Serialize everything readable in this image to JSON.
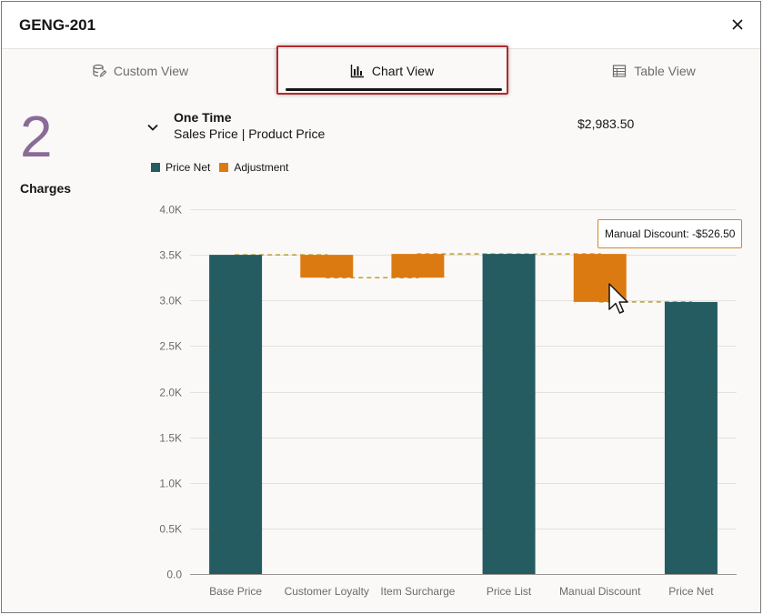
{
  "header": {
    "title": "GENG-201",
    "close_icon": "close-icon"
  },
  "tabs": [
    {
      "label": "Custom View",
      "icon": "database-edit-icon",
      "active": false
    },
    {
      "label": "Chart View",
      "icon": "bar-chart-icon",
      "active": true
    },
    {
      "label": "Table View",
      "icon": "table-icon",
      "active": false
    }
  ],
  "summary": {
    "count": "2",
    "label": "Charges"
  },
  "group": {
    "title": "One Time",
    "subtitle": "Sales Price | Product Price",
    "amount": "$2,983.50",
    "toggle_icon": "chevron-down-icon"
  },
  "tooltip": {
    "text": "Manual Discount: -$526.50"
  },
  "colors": {
    "price_net": "#245c62",
    "adjustment": "#dc7a12",
    "connector": "#b9a031",
    "highlight": "#b32a2a",
    "count": "#8b6c98"
  },
  "chart_data": {
    "type": "bar",
    "subtype": "waterfall",
    "legend": [
      "Price Net",
      "Adjustment"
    ],
    "legend_position": "top-left",
    "categories": [
      "Base Price",
      "Customer Loyalty",
      "Item Surcharge",
      "Price List",
      "Manual Discount",
      "Price Net"
    ],
    "series": [
      {
        "name": "Price Net",
        "kind": "total",
        "bars": [
          {
            "category": "Base Price",
            "start": 0,
            "end": 3500
          },
          {
            "category": "Price List",
            "start": 0,
            "end": 3510
          },
          {
            "category": "Price Net",
            "start": 0,
            "end": 2983.5
          }
        ]
      },
      {
        "name": "Adjustment",
        "kind": "delta",
        "bars": [
          {
            "category": "Customer Loyalty",
            "start": 3500,
            "end": 3250
          },
          {
            "category": "Item Surcharge",
            "start": 3250,
            "end": 3510
          },
          {
            "category": "Manual Discount",
            "start": 3510,
            "end": 2983.5
          }
        ]
      }
    ],
    "ylim": [
      0,
      4000
    ],
    "yticks": [
      "0.0",
      "0.5K",
      "1.0K",
      "1.5K",
      "2.0K",
      "2.5K",
      "3.0K",
      "3.5K",
      "4.0K"
    ],
    "ytick_values": [
      0,
      500,
      1000,
      1500,
      2000,
      2500,
      3000,
      3500,
      4000
    ],
    "grid": true,
    "xlabel": "",
    "ylabel": ""
  }
}
